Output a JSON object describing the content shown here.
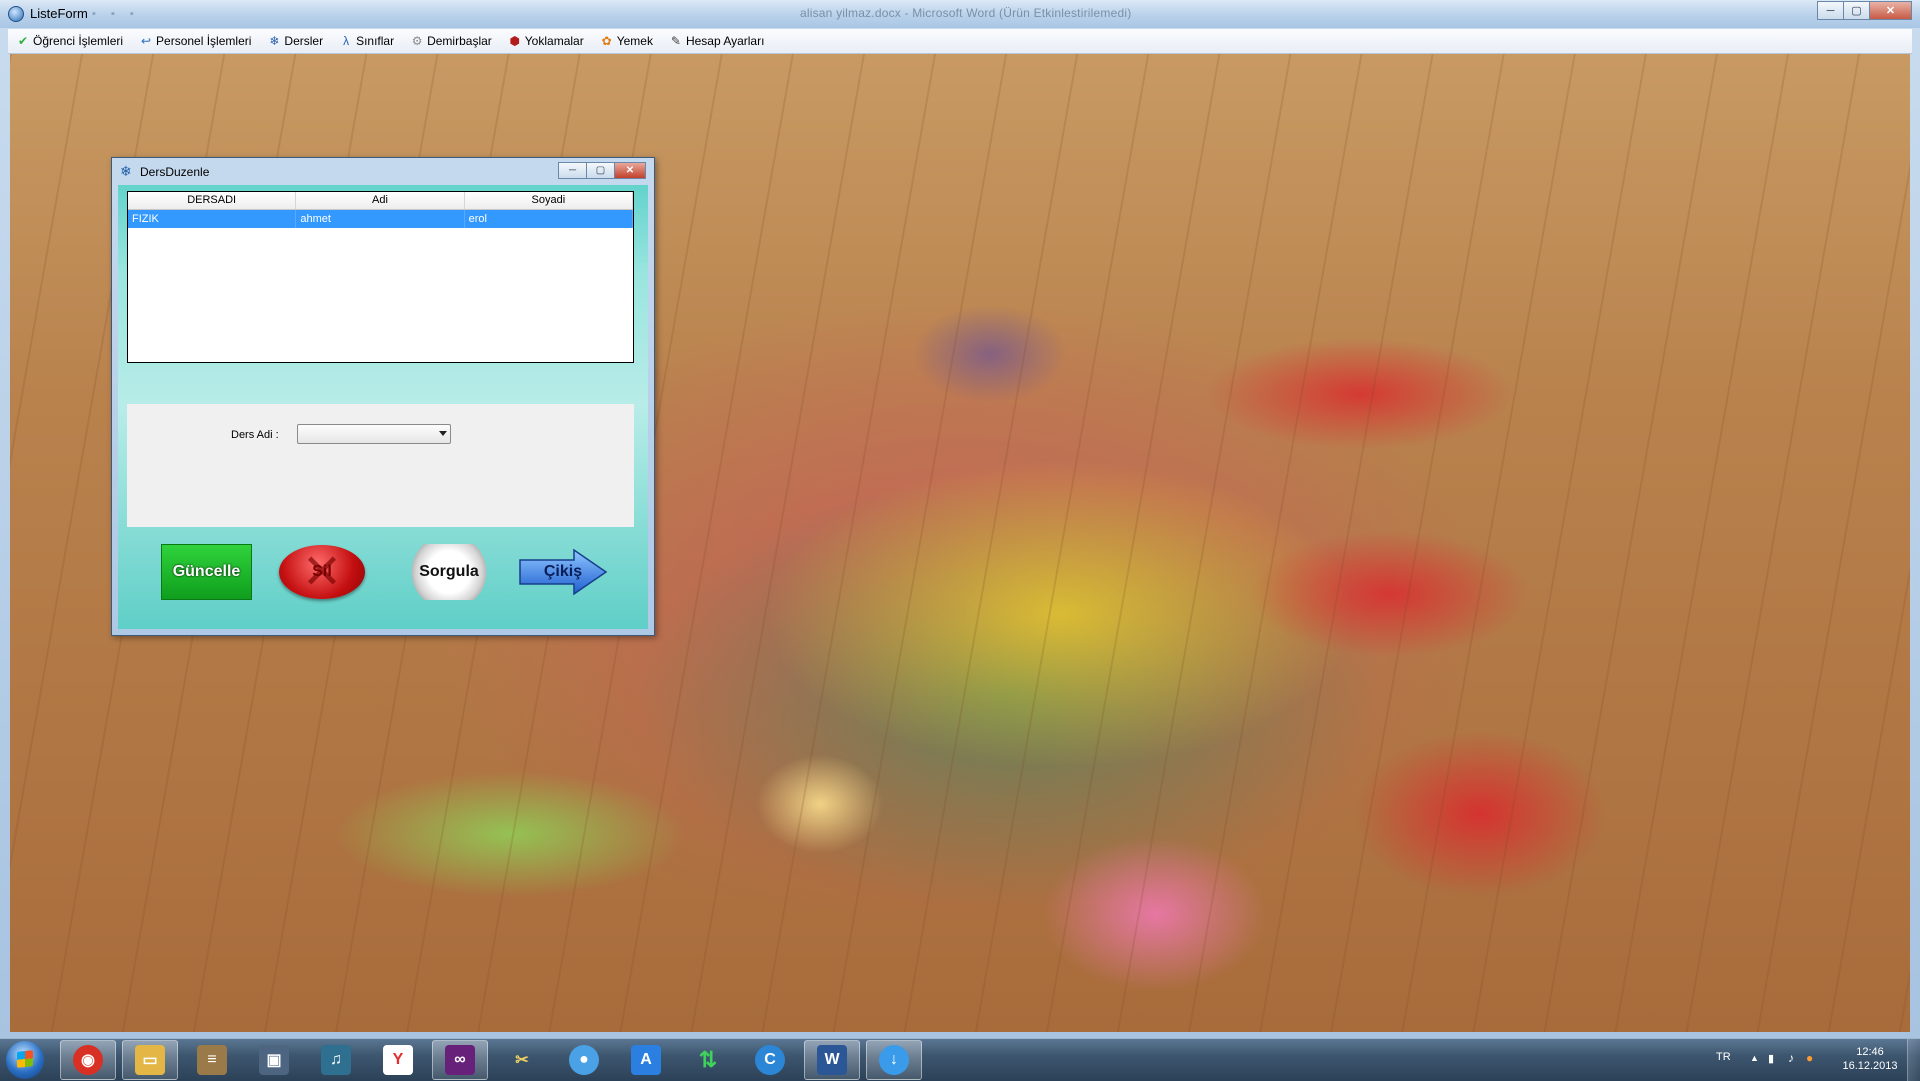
{
  "main_window": {
    "title": "ListeForm",
    "background_title": "alisan yilmaz.docx - Microsoft Word (Ürün Etkinlestirilemedi)",
    "controls": {
      "minimize": "─",
      "maximize": "▢",
      "close": "✕"
    }
  },
  "menubar": {
    "items": [
      {
        "label": "Öğrenci İşlemleri",
        "icon": "green-check-icon",
        "glyph": "✔",
        "color": "#2db23a"
      },
      {
        "label": "Personel İşlemleri",
        "icon": "return-arrow-icon",
        "glyph": "↩",
        "color": "#2c6fc0"
      },
      {
        "label": "Dersler",
        "icon": "snowflake-icon",
        "glyph": "❄",
        "color": "#2a62b0"
      },
      {
        "label": "Sınıflar",
        "icon": "lambda-icon",
        "glyph": "λ",
        "color": "#2a62b0"
      },
      {
        "label": "Demirbaşlar",
        "icon": "gear-icon",
        "glyph": "⚙",
        "color": "#8a8a8a"
      },
      {
        "label": "Yoklamalar",
        "icon": "shield-icon",
        "glyph": "⬢",
        "color": "#b21c1c"
      },
      {
        "label": "Yemek",
        "icon": "food-icon",
        "glyph": "✿",
        "color": "#e07b12"
      },
      {
        "label": "Hesap Ayarları",
        "icon": "notepad-icon",
        "glyph": "✎",
        "color": "#404040"
      }
    ]
  },
  "dialog": {
    "title": "DersDuzenle",
    "icon": "snowflake-icon",
    "controls": {
      "minimize": "─",
      "maximize": "▢",
      "close": "✕"
    },
    "grid": {
      "columns": [
        "DERSADI",
        "Adi",
        "Soyadi"
      ],
      "rows": [
        {
          "cells": [
            "FIZIK",
            "ahmet",
            "erol"
          ],
          "selected": true
        }
      ]
    },
    "form": {
      "ders_adi_label": "Ders Adi :",
      "ders_adi_value": ""
    },
    "buttons": {
      "guncelle": "Güncelle",
      "sil": "Sil",
      "sorgula": "Sorgula",
      "cikis": "Çikiş"
    }
  },
  "taskbar": {
    "apps": [
      {
        "name": "chrome",
        "icon": "chrome-icon",
        "glyph": "◉",
        "color": "#d93025",
        "active": true
      },
      {
        "name": "explorer",
        "icon": "folder-icon",
        "glyph": "▭",
        "color": "#e4b645",
        "active": true
      },
      {
        "name": "books",
        "icon": "books-icon",
        "glyph": "≡",
        "color": "#9b7a4a",
        "active": false
      },
      {
        "name": "movie-maker",
        "icon": "film-icon",
        "glyph": "▣",
        "color": "#4d6580",
        "active": false
      },
      {
        "name": "media-tool",
        "icon": "media-icon",
        "glyph": "♫",
        "color": "#2f6f8f",
        "active": false
      },
      {
        "name": "yandex",
        "icon": "yandex-icon",
        "glyph": "Y",
        "color": "#e42d2d",
        "active": false
      },
      {
        "name": "visual-studio",
        "icon": "visual-studio-icon",
        "glyph": "∞",
        "color": "#68217a",
        "active": true
      },
      {
        "name": "tools",
        "icon": "tools-icon",
        "glyph": "✂",
        "color": "#c9a12d",
        "active": false
      },
      {
        "name": "skype",
        "icon": "chat-icon",
        "glyph": "●",
        "color": "#4aa1e6",
        "active": false
      },
      {
        "name": "app-store",
        "icon": "a-icon",
        "glyph": "A",
        "color": "#2b7fe0",
        "active": false
      },
      {
        "name": "torrent",
        "icon": "arrows-updown-icon",
        "glyph": "⇅",
        "color": "#2ea043",
        "active": false
      },
      {
        "name": "browser-c",
        "icon": "c-browser-icon",
        "glyph": "C",
        "color": "#2b86d6",
        "active": false
      },
      {
        "name": "word",
        "icon": "word-icon",
        "glyph": "W",
        "color": "#2b5797",
        "active": true
      },
      {
        "name": "download",
        "icon": "download-icon",
        "glyph": "↓",
        "color": "#3a9bea",
        "active": true
      }
    ],
    "tray": {
      "language": "TR",
      "time": "12:46",
      "date": "16.12.2013"
    }
  }
}
